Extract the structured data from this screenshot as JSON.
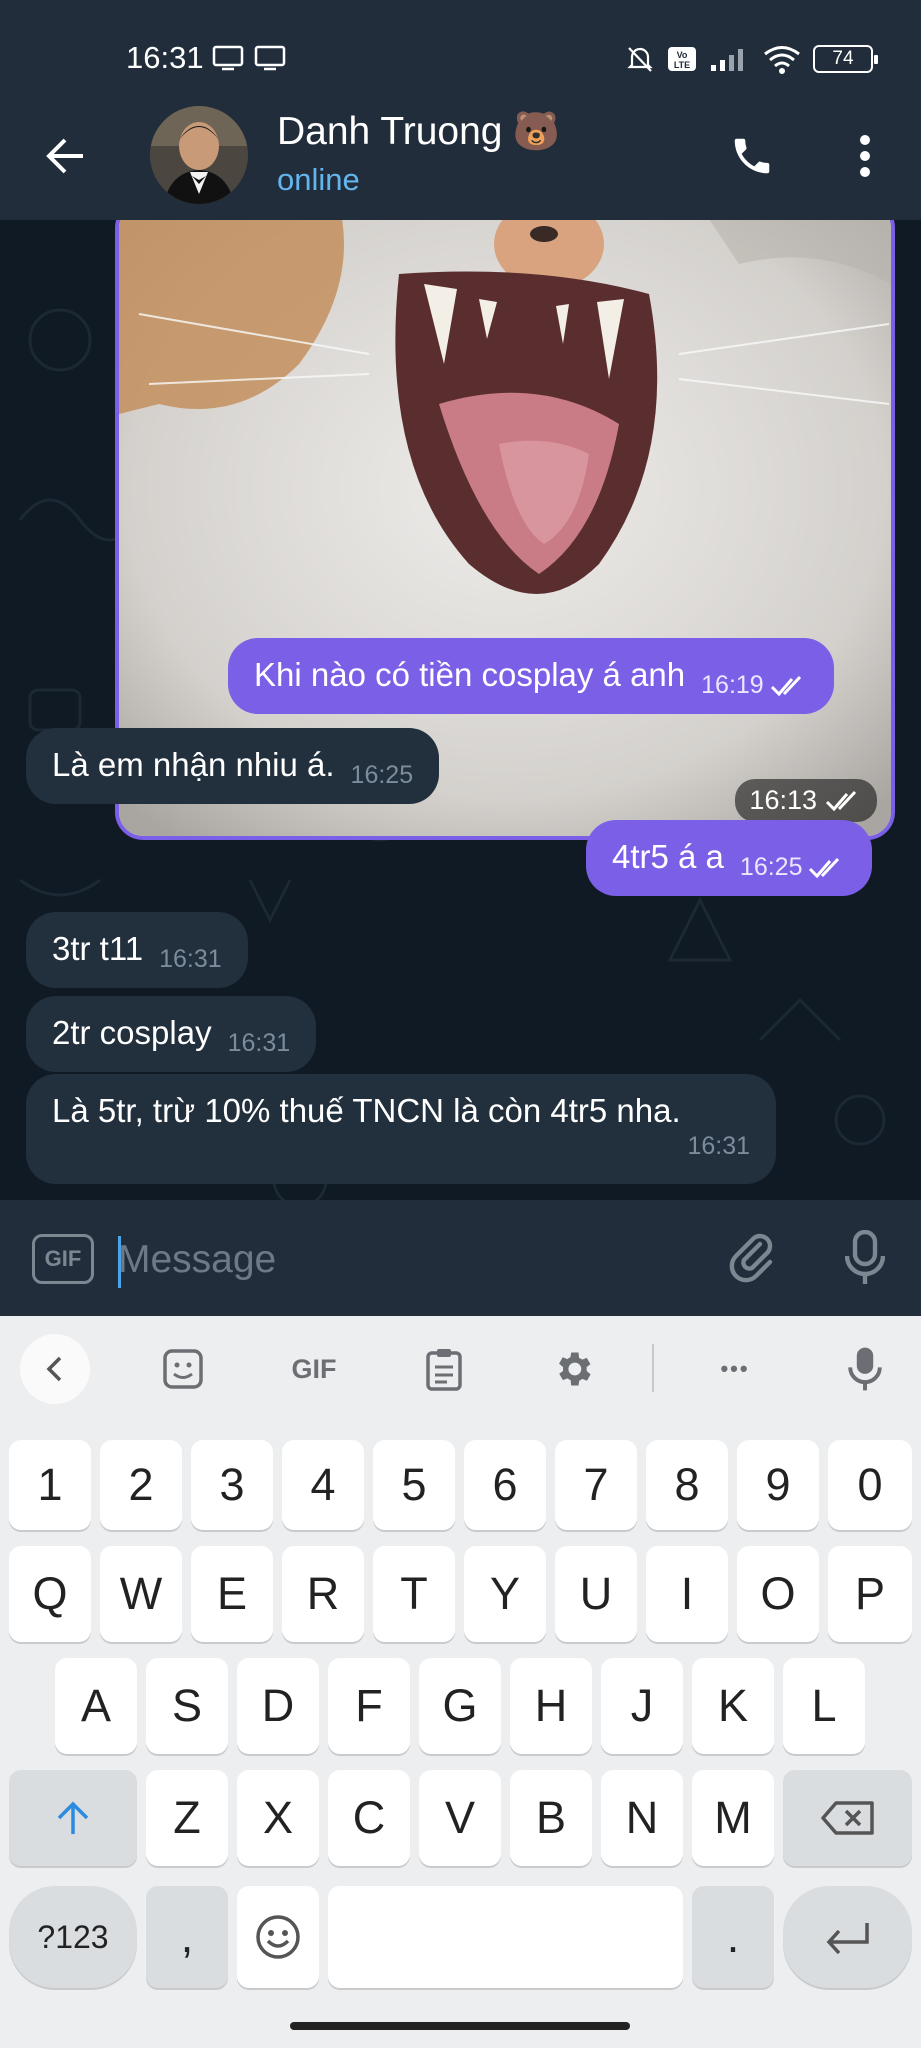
{
  "status_bar": {
    "time": "16:31",
    "battery": "74"
  },
  "header": {
    "contact_name": "Danh Truong",
    "name_emoji": "🐻",
    "status": "online"
  },
  "messages": [
    {
      "direction": "out",
      "type": "photo",
      "time": "16:13",
      "read": true
    },
    {
      "direction": "out",
      "text": "Khi nào có tiền cosplay á anh",
      "time": "16:19",
      "read": true
    },
    {
      "direction": "in",
      "text": "Là em nhận nhiu á.",
      "time": "16:25"
    },
    {
      "direction": "out",
      "text": "4tr5 á a",
      "time": "16:25",
      "read": true
    },
    {
      "direction": "in",
      "text": "3tr t11",
      "time": "16:31"
    },
    {
      "direction": "in",
      "text": "2tr cosplay",
      "time": "16:31"
    },
    {
      "direction": "in",
      "text": "Là 5tr, trừ 10% thuế TNCN là còn 4tr5 nha.",
      "time": "16:31"
    }
  ],
  "input": {
    "gif_label": "GIF",
    "placeholder": "Message",
    "value": ""
  },
  "keyboard": {
    "toolbar": {
      "gif_label": "GIF",
      "more_label": "•••"
    },
    "row_numbers": [
      "1",
      "2",
      "3",
      "4",
      "5",
      "6",
      "7",
      "8",
      "9",
      "0"
    ],
    "row_1": [
      "Q",
      "W",
      "E",
      "R",
      "T",
      "Y",
      "U",
      "I",
      "O",
      "P"
    ],
    "row_2": [
      "A",
      "S",
      "D",
      "F",
      "G",
      "H",
      "J",
      "K",
      "L"
    ],
    "row_3": [
      "Z",
      "X",
      "C",
      "V",
      "B",
      "N",
      "M"
    ],
    "symbols_label": "?123",
    "comma": ",",
    "period": "."
  },
  "colors": {
    "header_bg": "#212d3b",
    "chat_bg": "#0f1a24",
    "outgoing_bubble": "#7b5fe6",
    "incoming_bubble": "#222f3d",
    "online_status": "#64b5ef",
    "keyboard_bg": "#eceef0"
  }
}
